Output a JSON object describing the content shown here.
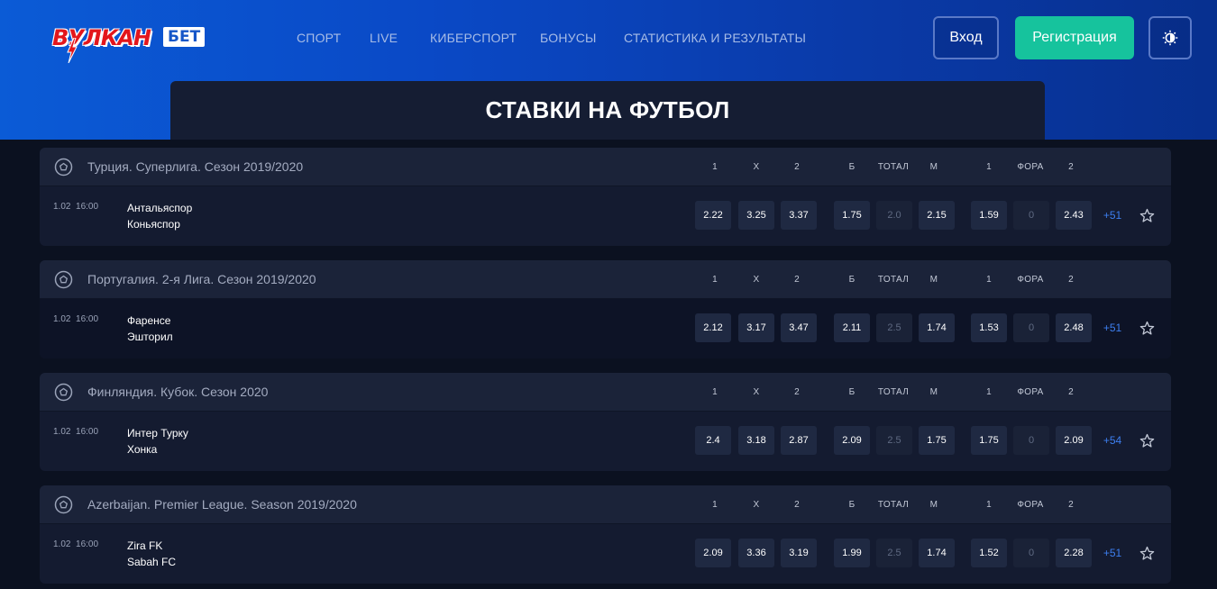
{
  "brand": {
    "logo_text": "ВУЛКАН",
    "logo_badge": "БЕТ",
    "logo_color": "#e3161c"
  },
  "nav": {
    "items": [
      {
        "label": "СПОРТ"
      },
      {
        "label": "LIVE"
      },
      {
        "label": "КИБЕРСПОРТ"
      },
      {
        "label": "БОНУСЫ"
      },
      {
        "label": "СТАТИСТИКА И РЕЗУЛЬТАТЫ"
      }
    ]
  },
  "header": {
    "login_label": "Вход",
    "register_label": "Регистрация",
    "theme_icon": "theme-toggle-icon",
    "accent_color": "#16c39d"
  },
  "page": {
    "title": "СТАВКИ НА ФУТБОЛ"
  },
  "columns": [
    "1",
    "X",
    "2",
    "Б",
    "ТОТАЛ",
    "М",
    "1",
    "ФОРА",
    "2"
  ],
  "leagues": [
    {
      "name": "Турция. Суперлига. Сезон 2019/2020",
      "match": {
        "date": "1.02",
        "time": "16:00",
        "team1": "Антальяспор",
        "team2": "Коньяспор",
        "odds": [
          "2.22",
          "3.25",
          "3.37",
          "1.75",
          "2.0",
          "2.15",
          "1.59",
          "0",
          "2.43"
        ],
        "more": "+51"
      }
    },
    {
      "name": "Португалия. 2-я Лига. Сезон 2019/2020",
      "match": {
        "date": "1.02",
        "time": "16:00",
        "team1": "Фаренсе",
        "team2": "Эшторил",
        "odds": [
          "2.12",
          "3.17",
          "3.47",
          "2.11",
          "2.5",
          "1.74",
          "1.53",
          "0",
          "2.48"
        ],
        "more": "+51"
      }
    },
    {
      "name": "Финляндия. Кубок. Сезон 2020",
      "match": {
        "date": "1.02",
        "time": "16:00",
        "team1": "Интер Турку",
        "team2": "Хонка",
        "odds": [
          "2.4",
          "3.18",
          "2.87",
          "2.09",
          "2.5",
          "1.75",
          "1.75",
          "0",
          "2.09"
        ],
        "more": "+54"
      }
    },
    {
      "name": "Azerbaijan. Premier League. Season 2019/2020",
      "match": {
        "date": "1.02",
        "time": "16:00",
        "team1": "Zira FK",
        "team2": "Sabah FC",
        "odds": [
          "2.09",
          "3.36",
          "3.19",
          "1.99",
          "2.5",
          "1.74",
          "1.52",
          "0",
          "2.28"
        ],
        "more": "+51"
      }
    }
  ]
}
